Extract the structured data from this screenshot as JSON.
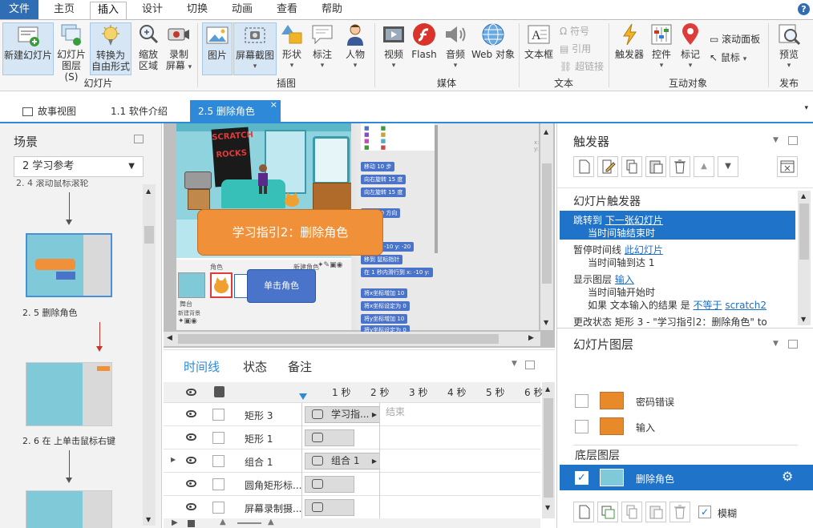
{
  "menu": {
    "items": [
      "文件",
      "主页",
      "插入",
      "设计",
      "切换",
      "动画",
      "查看",
      "帮助"
    ],
    "active_index": 2,
    "help": "?"
  },
  "ribbon": {
    "slides_group": {
      "label": "幻灯片",
      "new_slide": "新建幻灯片",
      "slide_layers_1": "幻灯片",
      "slide_layers_2": "图层(S)",
      "convert_1": "转换为",
      "convert_2": "自由形式",
      "zoom_1": "缩放",
      "zoom_2": "区域",
      "record_1": "录制",
      "record_2": "屏幕"
    },
    "illustrations_group": {
      "label": "插图",
      "picture": "图片",
      "screenshot": "屏幕截图",
      "shape": "形状",
      "caption": "标注",
      "character": "人物"
    },
    "media_group": {
      "label": "媒体",
      "video": "视频",
      "flash": "Flash",
      "audio": "音频",
      "web": "Web 对象"
    },
    "text_group": {
      "label": "文本",
      "textbox": "文本框",
      "symbol": "符号",
      "reference": "引用",
      "hyperlink": "超链接"
    },
    "interactive_group": {
      "label": "互动对象",
      "trigger": "触发器",
      "control": "控件",
      "marker": "标记",
      "scroll_panel": "滚动面板",
      "mouse": "鼠标"
    },
    "publish_group": {
      "label": "发布",
      "preview": "预览"
    }
  },
  "tabs": [
    "故事视图",
    "1.1 软件介绍",
    "2.5 删除角色"
  ],
  "tab_active_index": 2,
  "scenes": {
    "title": "场景",
    "scene_select": "2 学习参考",
    "top_partial_label": "2. 4 滚动鼠标滚轮",
    "items": [
      {
        "label": "2. 5 删除角色",
        "selected": true
      },
      {
        "label": "2. 6 在 上单击鼠标右键",
        "selected": false
      }
    ]
  },
  "stage": {
    "poster_text": "SCRATCH\nROCKS",
    "callout_text": "学习指引2：删除角色",
    "click_tip": "单击角色",
    "code_blocks": [
      "移动 10 步",
      "向右旋转 15 度",
      "向左旋转 15 度",
      "面向 90 方向",
      "移到 x: -10 y: -20",
      "移到 鼠标指针",
      "在 1 秒内滑行到 x: -10 y:",
      "将x坐标增加 10",
      "将x坐标设定为 0",
      "将y坐标增加 10",
      "将y坐标设定为 0"
    ],
    "sprite_panel_label": "角色",
    "new_sprite_label": "新建角色",
    "stage_label": "舞台",
    "new_bg_label": "新建背景"
  },
  "timeline": {
    "tabs": [
      "时间线",
      "状态",
      "备注"
    ],
    "active_tab": 0,
    "ruler": [
      "1 秒",
      "2 秒",
      "3 秒",
      "4 秒",
      "5 秒",
      "6 秒"
    ],
    "end_label": "结束",
    "rows": [
      {
        "name": "矩形 3",
        "block": "学习指...",
        "expand": false
      },
      {
        "name": "矩形 1",
        "block": "",
        "expand": false
      },
      {
        "name": "组合 1",
        "block": "组合 1",
        "expand": true
      },
      {
        "name": "圆角矩形标...",
        "block": "",
        "expand": false
      },
      {
        "name": "屏幕录制摄...",
        "block": "",
        "expand": false
      }
    ]
  },
  "triggers": {
    "title": "触发器",
    "slide_triggers_title": "幻灯片触发器",
    "items": [
      {
        "action": "跳转到",
        "target": "下一张幻灯片",
        "when": "当时间轴结束时",
        "selected": true
      },
      {
        "action": "暂停时间线",
        "target": "此幻灯片",
        "when": "当时间轴到达 1",
        "selected": false
      },
      {
        "action": "显示图层",
        "target": "输入",
        "when": "当时间轴开始时",
        "condition_prefix": "如果 文本输入的结果 是",
        "condition_op": "不等于",
        "condition_val": "scratch2",
        "selected": false
      }
    ],
    "cut_off_line": "更改状态 矩形 3 - \"学习指引2：删除角色\" to"
  },
  "layers": {
    "title": "幻灯片图层",
    "items": [
      {
        "name": "密码错误"
      },
      {
        "name": "输入"
      }
    ],
    "base_title": "底层图层",
    "base_layer": "删除角色",
    "dim_label": "模糊"
  },
  "colors": {
    "accent": "#2e8ad8",
    "file_menu": "#2f6eb5",
    "selected_row": "#1f73c9",
    "callout_orange": "#f0913a",
    "code_blue": "#4a74c9",
    "arrow_red": "#c0392b"
  }
}
